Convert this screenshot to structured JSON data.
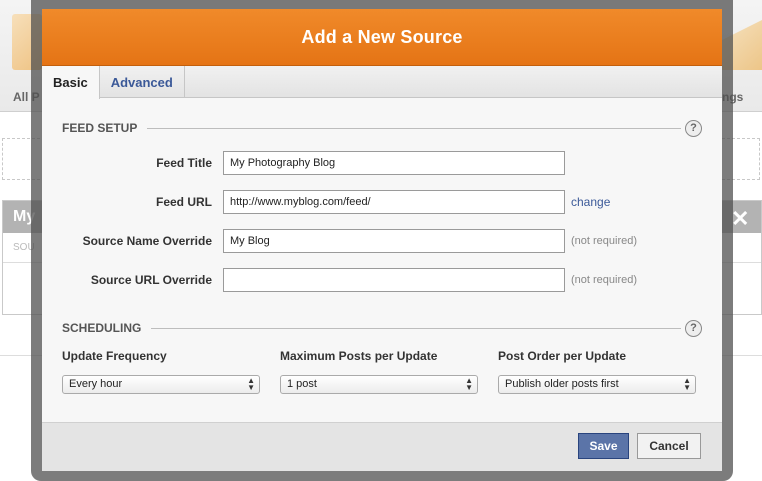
{
  "background": {
    "left_nav_text": "All P",
    "right_nav_text": "ngs",
    "panel_title": "My",
    "panel_sub": "SOU"
  },
  "modal": {
    "title": "Add a New Source",
    "tabs": [
      {
        "label": "Basic",
        "active": true
      },
      {
        "label": "Advanced",
        "active": false
      }
    ],
    "feed_setup": {
      "heading": "FEED SETUP",
      "help": "?",
      "fields": [
        {
          "label": "Feed Title",
          "value": "My Photography Blog",
          "aside": ""
        },
        {
          "label": "Feed URL",
          "value": "http://www.myblog.com/feed/",
          "link": "change"
        },
        {
          "label": "Source Name Override",
          "value": "My Blog",
          "aside": "(not required)"
        },
        {
          "label": "Source URL Override",
          "value": "",
          "aside": "(not required)"
        }
      ]
    },
    "scheduling": {
      "heading": "SCHEDULING",
      "help": "?",
      "columns": [
        {
          "label": "Update Frequency",
          "selected": "Every hour"
        },
        {
          "label": "Maximum Posts per Update",
          "selected": "1 post"
        },
        {
          "label": "Post Order per Update",
          "selected": "Publish older posts first"
        }
      ]
    },
    "buttons": {
      "save": "Save",
      "cancel": "Cancel"
    }
  },
  "colors": {
    "header_orange": "#ec7f20",
    "link_blue": "#3b5998",
    "save_blue": "#5b74a8"
  }
}
